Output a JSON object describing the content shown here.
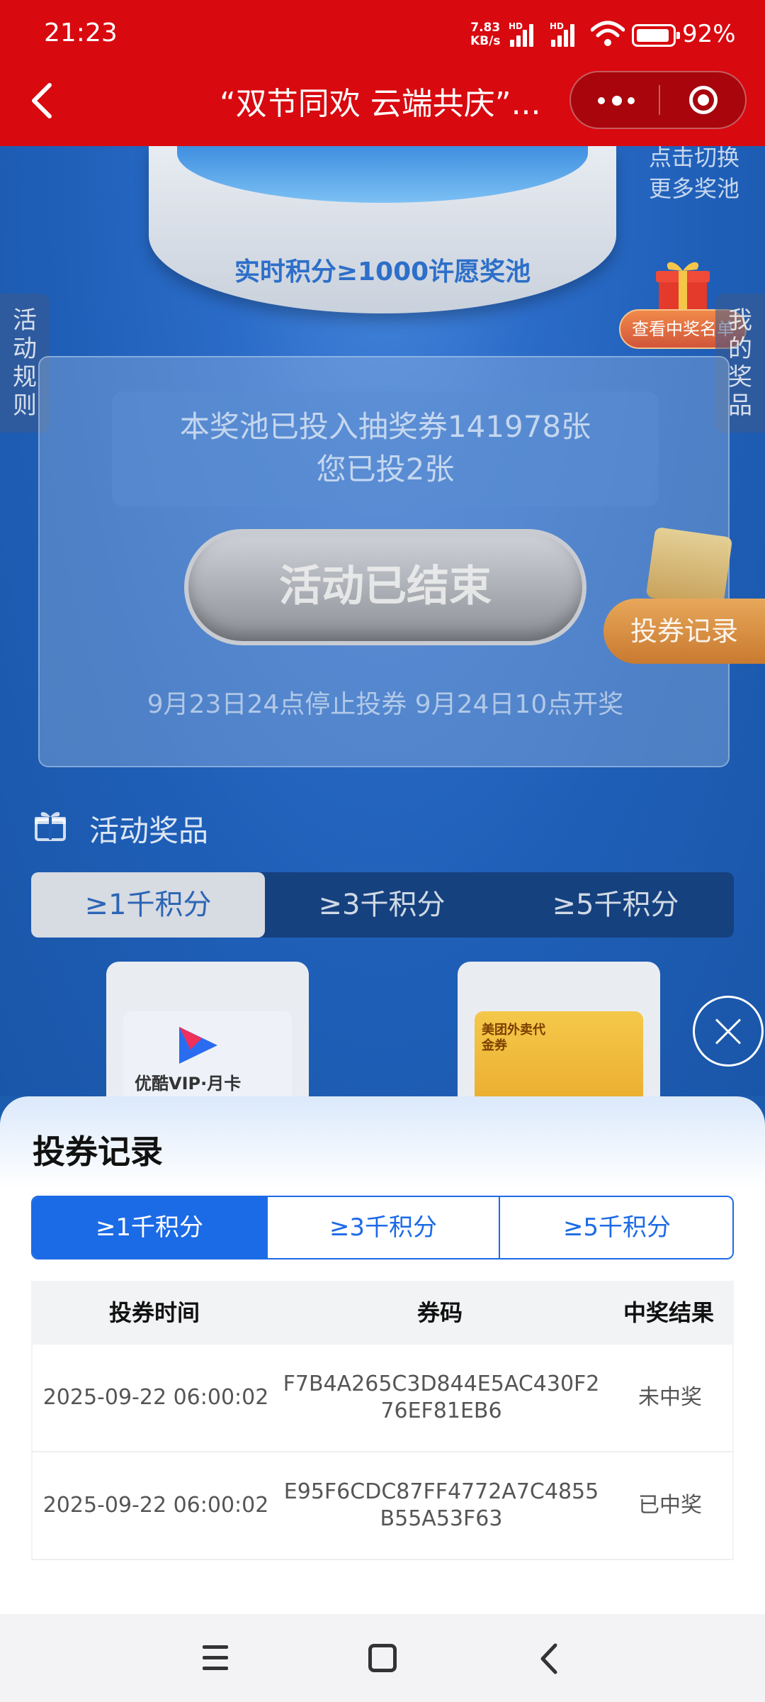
{
  "status_bar": {
    "time": "21:23",
    "net_speed_value": "7.83",
    "net_speed_unit": "KB/s",
    "network_badge_1": "HD",
    "network_badge_2": "HD",
    "battery_percent": "92%",
    "battery_level": 0.92
  },
  "title_bar": {
    "title": "“双节同欢 云端共庆”..."
  },
  "background": {
    "pool_label": "实时积分≥1000许愿奖池",
    "switch_pool_line1": "点击切换",
    "switch_pool_line2": "更多奖池",
    "winners_button": "查看中奖名单",
    "rules_tab": "活动规则",
    "my_prizes_tab": "我的奖品",
    "pool_info_line1": "本奖池已投入抽奖券141978张",
    "pool_info_line2": "您已投2张",
    "ended_button": "活动已结束",
    "schedule": "9月23日24点停止投券 9月24日10点开奖",
    "ticket_record_button": "投券记录",
    "prizes_heading": "活动奖品",
    "prize_tabs": [
      "≥1千积分",
      "≥3千积分",
      "≥5千积分"
    ],
    "prize_cards": [
      {
        "label": "优酷VIP·月卡"
      },
      {
        "label": "美团外卖代金券"
      }
    ]
  },
  "sheet": {
    "title": "投券记录",
    "tabs": [
      "≥1千积分",
      "≥3千积分",
      "≥5千积分"
    ],
    "active_tab": 0,
    "columns": [
      "投券时间",
      "券码",
      "中奖结果"
    ],
    "rows": [
      {
        "time": "2025-09-22 06:00:02",
        "code": "F7B4A265C3D844E5AC430F276EF81EB6",
        "result": "未中奖"
      },
      {
        "time": "2025-09-22 06:00:02",
        "code": "E95F6CDC87FF4772A7C4855B55A53F63",
        "result": "已中奖"
      }
    ]
  },
  "colors": {
    "title_bar": "#d8090f",
    "accent_blue": "#1c6be6",
    "background_blue": "#1c5cae"
  }
}
